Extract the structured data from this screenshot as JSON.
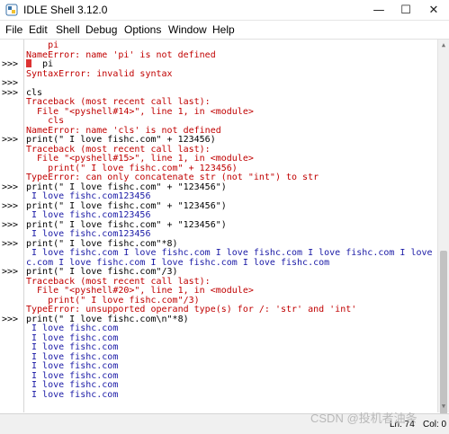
{
  "window": {
    "title": "IDLE Shell 3.12.0",
    "controls": [
      "—",
      "☐",
      "✕"
    ]
  },
  "menu": [
    "File",
    "Edit",
    "Shell",
    "Debug",
    "Options",
    "Window",
    "Help"
  ],
  "lines": [
    {
      "p": "",
      "t": "    pi",
      "c": "red"
    },
    {
      "p": "",
      "t": "NameError: name 'pi' is not defined",
      "c": "red"
    },
    {
      "p": ">>>",
      "t": "  pi",
      "c": "dark",
      "marker": true
    },
    {
      "p": "",
      "t": "SyntaxError: invalid syntax",
      "c": "red"
    },
    {
      "p": ">>>",
      "t": "",
      "c": "dark"
    },
    {
      "p": ">>>",
      "t": "cls",
      "c": "dark"
    },
    {
      "p": "",
      "t": "Traceback (most recent call last):",
      "c": "red"
    },
    {
      "p": "",
      "t": "  File \"<pyshell#14>\", line 1, in <module>",
      "c": "red"
    },
    {
      "p": "",
      "t": "    cls",
      "c": "red"
    },
    {
      "p": "",
      "t": "NameError: name 'cls' is not defined",
      "c": "red"
    },
    {
      "p": ">>>",
      "t": "print(\" I love fishc.com\" + 123456)",
      "c": "dark"
    },
    {
      "p": "",
      "t": "Traceback (most recent call last):",
      "c": "red"
    },
    {
      "p": "",
      "t": "  File \"<pyshell#15>\", line 1, in <module>",
      "c": "red"
    },
    {
      "p": "",
      "t": "    print(\" I love fishc.com\" + 123456)",
      "c": "red"
    },
    {
      "p": "",
      "t": "TypeError: can only concatenate str (not \"int\") to str",
      "c": "red"
    },
    {
      "p": ">>>",
      "t": "print(\" I love fishc.com\" + \"123456\")",
      "c": "dark"
    },
    {
      "p": "",
      "t": " I love fishc.com123456",
      "c": "blue"
    },
    {
      "p": ">>>",
      "t": "print(\" I love fishc.com\" + \"123456\")",
      "c": "dark"
    },
    {
      "p": "",
      "t": " I love fishc.com123456",
      "c": "blue"
    },
    {
      "p": ">>>",
      "t": "print(\" I love fishc.com\" + \"123456\")",
      "c": "dark"
    },
    {
      "p": "",
      "t": " I love fishc.com123456",
      "c": "blue"
    },
    {
      "p": ">>>",
      "t": "print(\" I love fishc.com\"*8)",
      "c": "dark"
    },
    {
      "p": "",
      "t": " I love fishc.com I love fishc.com I love fishc.com I love fishc.com I love fish",
      "c": "blue"
    },
    {
      "p": "",
      "t": "c.com I love fishc.com I love fishc.com I love fishc.com",
      "c": "blue"
    },
    {
      "p": ">>>",
      "t": "print(\" I love fishc.com\"/3)",
      "c": "dark"
    },
    {
      "p": "",
      "t": "Traceback (most recent call last):",
      "c": "red"
    },
    {
      "p": "",
      "t": "  File \"<pyshell#20>\", line 1, in <module>",
      "c": "red"
    },
    {
      "p": "",
      "t": "    print(\" I love fishc.com\"/3)",
      "c": "red"
    },
    {
      "p": "",
      "t": "TypeError: unsupported operand type(s) for /: 'str' and 'int'",
      "c": "red"
    },
    {
      "p": ">>>",
      "t": "print(\" I love fishc.com\\n\"*8)",
      "c": "dark"
    },
    {
      "p": "",
      "t": " I love fishc.com",
      "c": "blue"
    },
    {
      "p": "",
      "t": " I love fishc.com",
      "c": "blue"
    },
    {
      "p": "",
      "t": " I love fishc.com",
      "c": "blue"
    },
    {
      "p": "",
      "t": " I love fishc.com",
      "c": "blue"
    },
    {
      "p": "",
      "t": " I love fishc.com",
      "c": "blue"
    },
    {
      "p": "",
      "t": " I love fishc.com",
      "c": "blue"
    },
    {
      "p": "",
      "t": " I love fishc.com",
      "c": "blue"
    },
    {
      "p": "",
      "t": " I love fishc.com",
      "c": "blue"
    },
    {
      "p": "",
      "t": "",
      "c": "blue"
    },
    {
      "p": "",
      "t": "",
      "c": "dark"
    },
    {
      "p": ">>>",
      "t": "",
      "c": "dark",
      "caret": true
    }
  ],
  "status": {
    "ln": "Ln: 74",
    "col": "Col: 0"
  },
  "watermark": "CSDN @投机者油条",
  "colors": {
    "output": "#1a1aa6",
    "error": "#c00000",
    "input": "#000000"
  }
}
